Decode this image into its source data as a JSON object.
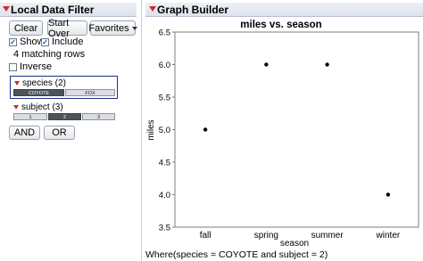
{
  "local_data_filter": {
    "title": "Local Data Filter",
    "buttons": {
      "clear": "Clear",
      "start_over": "Start Over",
      "favorites": "Favorites"
    },
    "show": {
      "label": "Show",
      "checked": true
    },
    "include": {
      "label": "Include",
      "checked": true
    },
    "matching_rows": "4 matching rows",
    "inverse": {
      "label": "Inverse",
      "checked": false
    },
    "filters": [
      {
        "title": "species (2)",
        "levels": [
          {
            "label": "COYOTE",
            "selected": true
          },
          {
            "label": "FOX",
            "selected": false
          }
        ]
      },
      {
        "title": "subject (3)",
        "levels": [
          {
            "label": "1",
            "selected": false
          },
          {
            "label": "2",
            "selected": true
          },
          {
            "label": "3",
            "selected": false
          }
        ]
      }
    ],
    "and_label": "AND",
    "or_label": "OR"
  },
  "graph_builder": {
    "title": "Graph Builder",
    "where_text": "Where(species = COYOTE and subject = 2)"
  },
  "chart_data": {
    "type": "scatter",
    "title": "miles vs. season",
    "xlabel": "season",
    "ylabel": "miles",
    "categories": [
      "fall",
      "spring",
      "summer",
      "winter"
    ],
    "values": [
      5.0,
      6.0,
      6.0,
      4.0
    ],
    "ylim": [
      3.5,
      6.5
    ],
    "yticks": [
      "3.5",
      "4.0",
      "4.5",
      "5.0",
      "5.5",
      "6.0",
      "6.5"
    ],
    "grid": false,
    "point_color": "#000000"
  }
}
